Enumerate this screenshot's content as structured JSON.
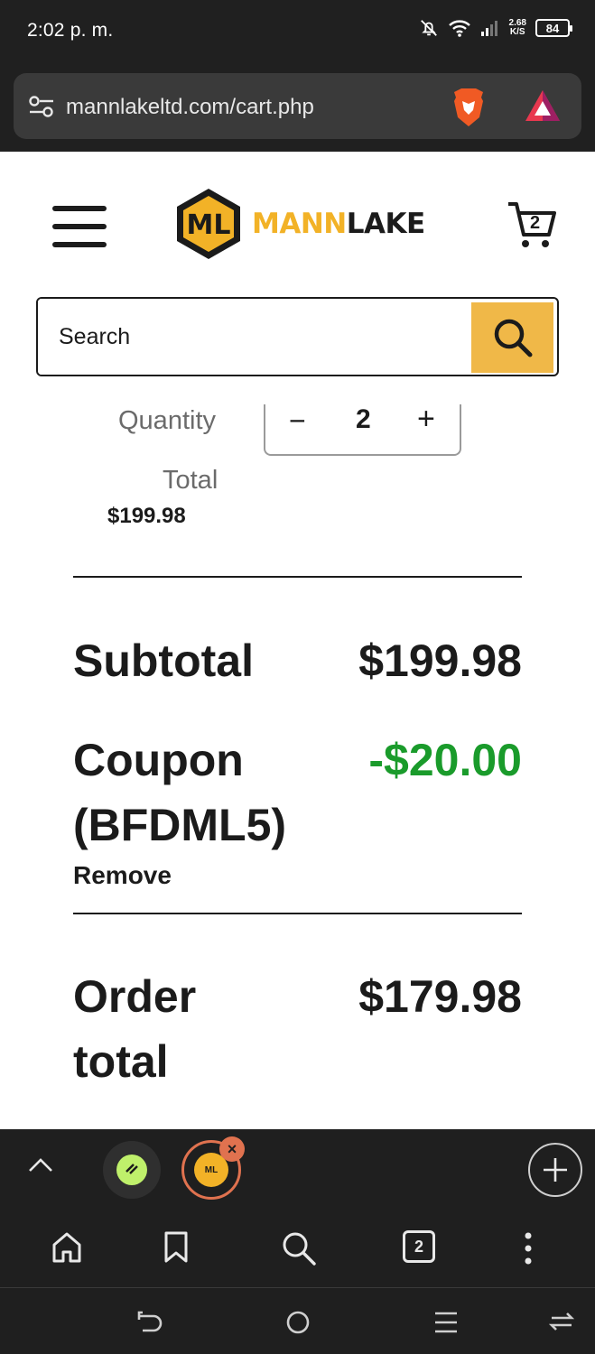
{
  "status_bar": {
    "time": "2:02 p. m.",
    "net_speed_top": "2.68",
    "net_speed_unit": "K/S",
    "battery": "84"
  },
  "browser": {
    "url": "mannlakeltd.com/cart.php",
    "tab_count": "2"
  },
  "site": {
    "brand_mann": "MANN",
    "brand_lake": "LAKE",
    "logo_initials": "ML",
    "cart_count": "2",
    "search_placeholder": "Search"
  },
  "cart_item": {
    "quantity_label": "Quantity",
    "quantity_value": "2",
    "total_label": "Total",
    "total_value": "$199.98"
  },
  "summary": {
    "subtotal_label": "Subtotal",
    "subtotal_value": "$199.98",
    "coupon_label_line1": "Coupon",
    "coupon_label_line2": "(BFDML5)",
    "coupon_value": "-$20.00",
    "remove_label": "Remove",
    "order_total_line1": "Order",
    "order_total_line2": "total",
    "order_total_value": "$179.98"
  },
  "colors": {
    "brand_yellow": "#f2b227",
    "search_button": "#f0b848",
    "discount_green": "#1a9b2b",
    "tab_accent": "#e0724f"
  }
}
